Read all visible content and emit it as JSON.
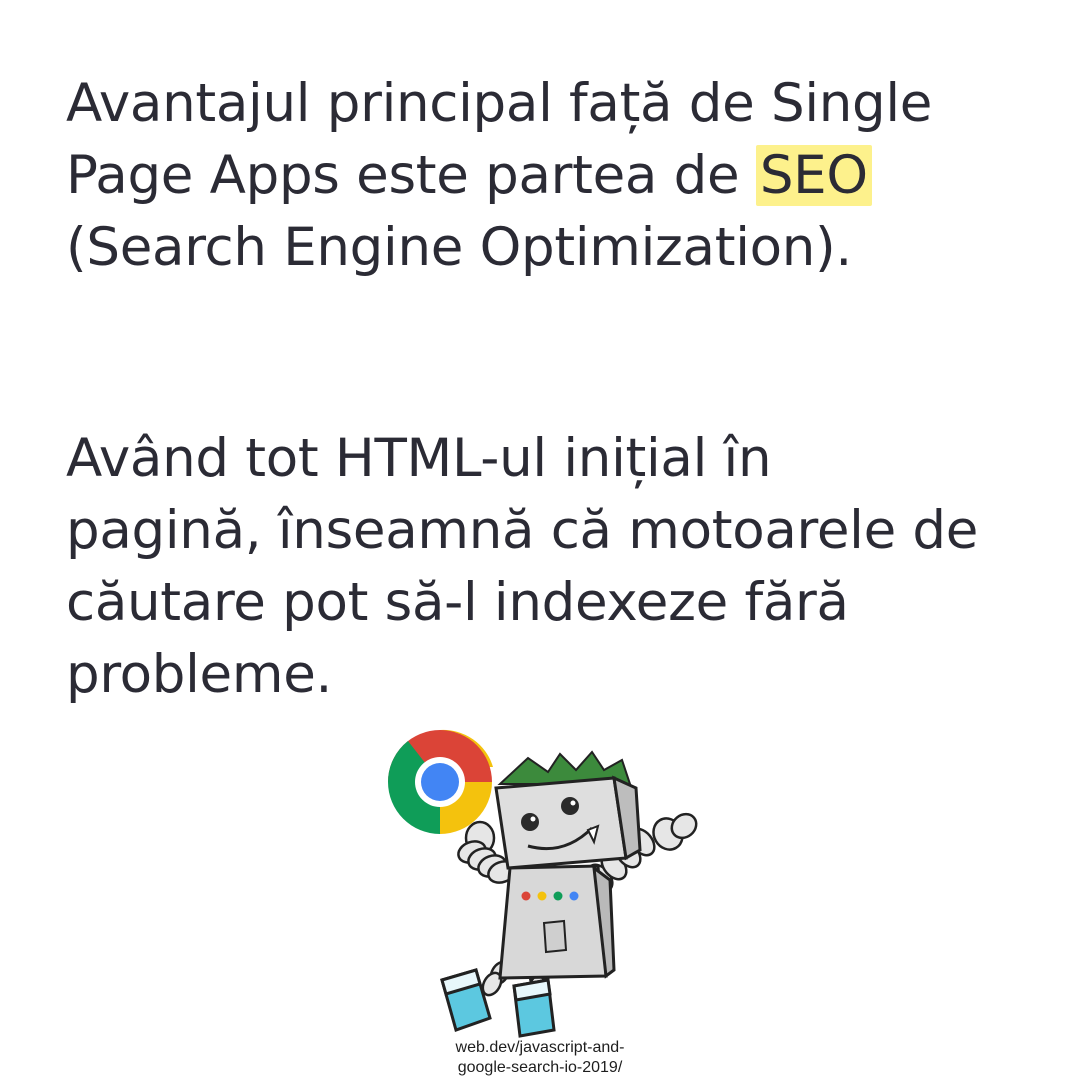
{
  "paragraph1": {
    "line1": "Avantajul principal față de Single",
    "line2_pre": "Page Apps este partea de ",
    "line2_highlight": "SEO",
    "line3": "(Search Engine Optimization)."
  },
  "paragraph2": {
    "lines": [
      "Având tot HTML-ul inițial în",
      "pagină, înseamnă că motoarele de",
      "căutare pot să-l indexeze fără",
      "probleme."
    ]
  },
  "illustration": {
    "icon": "googlebot-mascot-holding-chrome-logo-icon",
    "colors": {
      "chrome_red": "#db4437",
      "chrome_yellow": "#f4c20d",
      "chrome_green": "#0f9d58",
      "chrome_blue": "#4285f4",
      "hair": "#3c8a3c",
      "feet": "#5cc8e0"
    }
  },
  "caption": {
    "line1": "web.dev/javascript-and-",
    "line2": "google-search-io-2019/"
  },
  "colors": {
    "text": "#2b2b35",
    "highlight": "#fdf18c",
    "background": "#ffffff"
  }
}
